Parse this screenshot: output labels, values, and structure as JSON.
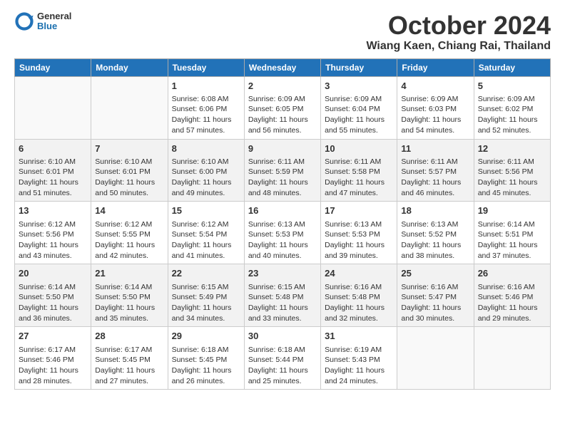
{
  "header": {
    "logo_general": "General",
    "logo_blue": "Blue",
    "month_title": "October 2024",
    "subtitle": "Wiang Kaen, Chiang Rai, Thailand"
  },
  "days_of_week": [
    "Sunday",
    "Monday",
    "Tuesday",
    "Wednesday",
    "Thursday",
    "Friday",
    "Saturday"
  ],
  "weeks": [
    [
      {
        "num": "",
        "info": ""
      },
      {
        "num": "",
        "info": ""
      },
      {
        "num": "1",
        "info": "Sunrise: 6:08 AM\nSunset: 6:06 PM\nDaylight: 11 hours and 57 minutes."
      },
      {
        "num": "2",
        "info": "Sunrise: 6:09 AM\nSunset: 6:05 PM\nDaylight: 11 hours and 56 minutes."
      },
      {
        "num": "3",
        "info": "Sunrise: 6:09 AM\nSunset: 6:04 PM\nDaylight: 11 hours and 55 minutes."
      },
      {
        "num": "4",
        "info": "Sunrise: 6:09 AM\nSunset: 6:03 PM\nDaylight: 11 hours and 54 minutes."
      },
      {
        "num": "5",
        "info": "Sunrise: 6:09 AM\nSunset: 6:02 PM\nDaylight: 11 hours and 52 minutes."
      }
    ],
    [
      {
        "num": "6",
        "info": "Sunrise: 6:10 AM\nSunset: 6:01 PM\nDaylight: 11 hours and 51 minutes."
      },
      {
        "num": "7",
        "info": "Sunrise: 6:10 AM\nSunset: 6:01 PM\nDaylight: 11 hours and 50 minutes."
      },
      {
        "num": "8",
        "info": "Sunrise: 6:10 AM\nSunset: 6:00 PM\nDaylight: 11 hours and 49 minutes."
      },
      {
        "num": "9",
        "info": "Sunrise: 6:11 AM\nSunset: 5:59 PM\nDaylight: 11 hours and 48 minutes."
      },
      {
        "num": "10",
        "info": "Sunrise: 6:11 AM\nSunset: 5:58 PM\nDaylight: 11 hours and 47 minutes."
      },
      {
        "num": "11",
        "info": "Sunrise: 6:11 AM\nSunset: 5:57 PM\nDaylight: 11 hours and 46 minutes."
      },
      {
        "num": "12",
        "info": "Sunrise: 6:11 AM\nSunset: 5:56 PM\nDaylight: 11 hours and 45 minutes."
      }
    ],
    [
      {
        "num": "13",
        "info": "Sunrise: 6:12 AM\nSunset: 5:56 PM\nDaylight: 11 hours and 43 minutes."
      },
      {
        "num": "14",
        "info": "Sunrise: 6:12 AM\nSunset: 5:55 PM\nDaylight: 11 hours and 42 minutes."
      },
      {
        "num": "15",
        "info": "Sunrise: 6:12 AM\nSunset: 5:54 PM\nDaylight: 11 hours and 41 minutes."
      },
      {
        "num": "16",
        "info": "Sunrise: 6:13 AM\nSunset: 5:53 PM\nDaylight: 11 hours and 40 minutes."
      },
      {
        "num": "17",
        "info": "Sunrise: 6:13 AM\nSunset: 5:53 PM\nDaylight: 11 hours and 39 minutes."
      },
      {
        "num": "18",
        "info": "Sunrise: 6:13 AM\nSunset: 5:52 PM\nDaylight: 11 hours and 38 minutes."
      },
      {
        "num": "19",
        "info": "Sunrise: 6:14 AM\nSunset: 5:51 PM\nDaylight: 11 hours and 37 minutes."
      }
    ],
    [
      {
        "num": "20",
        "info": "Sunrise: 6:14 AM\nSunset: 5:50 PM\nDaylight: 11 hours and 36 minutes."
      },
      {
        "num": "21",
        "info": "Sunrise: 6:14 AM\nSunset: 5:50 PM\nDaylight: 11 hours and 35 minutes."
      },
      {
        "num": "22",
        "info": "Sunrise: 6:15 AM\nSunset: 5:49 PM\nDaylight: 11 hours and 34 minutes."
      },
      {
        "num": "23",
        "info": "Sunrise: 6:15 AM\nSunset: 5:48 PM\nDaylight: 11 hours and 33 minutes."
      },
      {
        "num": "24",
        "info": "Sunrise: 6:16 AM\nSunset: 5:48 PM\nDaylight: 11 hours and 32 minutes."
      },
      {
        "num": "25",
        "info": "Sunrise: 6:16 AM\nSunset: 5:47 PM\nDaylight: 11 hours and 30 minutes."
      },
      {
        "num": "26",
        "info": "Sunrise: 6:16 AM\nSunset: 5:46 PM\nDaylight: 11 hours and 29 minutes."
      }
    ],
    [
      {
        "num": "27",
        "info": "Sunrise: 6:17 AM\nSunset: 5:46 PM\nDaylight: 11 hours and 28 minutes."
      },
      {
        "num": "28",
        "info": "Sunrise: 6:17 AM\nSunset: 5:45 PM\nDaylight: 11 hours and 27 minutes."
      },
      {
        "num": "29",
        "info": "Sunrise: 6:18 AM\nSunset: 5:45 PM\nDaylight: 11 hours and 26 minutes."
      },
      {
        "num": "30",
        "info": "Sunrise: 6:18 AM\nSunset: 5:44 PM\nDaylight: 11 hours and 25 minutes."
      },
      {
        "num": "31",
        "info": "Sunrise: 6:19 AM\nSunset: 5:43 PM\nDaylight: 11 hours and 24 minutes."
      },
      {
        "num": "",
        "info": ""
      },
      {
        "num": "",
        "info": ""
      }
    ]
  ]
}
